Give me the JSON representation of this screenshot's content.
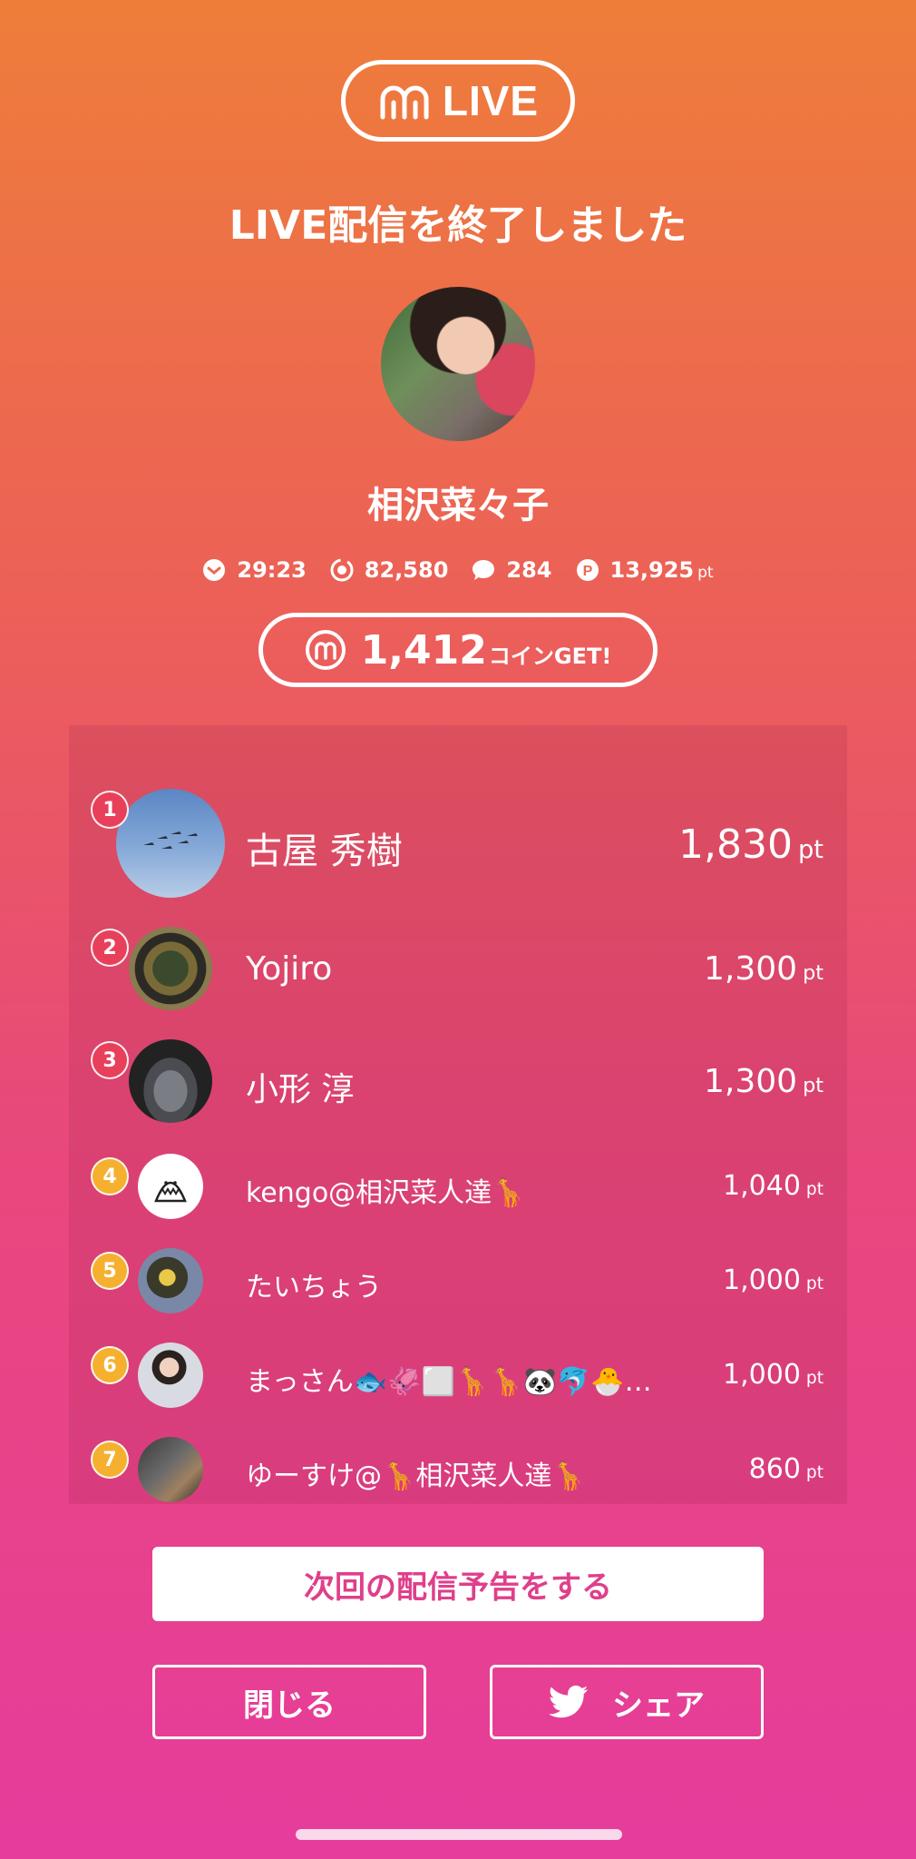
{
  "header": {
    "logo_text": "LIVE",
    "title": "LIVE配信を終了しました"
  },
  "streamer": {
    "name": "相沢菜々子"
  },
  "stats": {
    "duration": "29:23",
    "views": "82,580",
    "comments": "284",
    "points": "13,925",
    "points_unit": "pt"
  },
  "coins": {
    "amount": "1,412",
    "suffix": "コインGET!"
  },
  "ranking": [
    {
      "rank": "1",
      "name": "古屋 秀樹",
      "points": "1,830",
      "unit": "pt"
    },
    {
      "rank": "2",
      "name": "Yojiro",
      "points": "1,300",
      "unit": "pt"
    },
    {
      "rank": "3",
      "name": "小形 淳",
      "points": "1,300",
      "unit": "pt"
    },
    {
      "rank": "4",
      "name": "kengo@相沢菜人達🦒",
      "points": "1,040",
      "unit": "pt"
    },
    {
      "rank": "5",
      "name": "たいちょう",
      "points": "1,000",
      "unit": "pt"
    },
    {
      "rank": "6",
      "name": "まっさん🐟🦑⬜🦒🦒🐼🐬🐣…",
      "points": "1,000",
      "unit": "pt"
    },
    {
      "rank": "7",
      "name": "ゆーすけ@🦒相沢菜人達🦒",
      "points": "860",
      "unit": "pt"
    }
  ],
  "buttons": {
    "preview": "次回の配信予告をする",
    "close": "閉じる",
    "share": "シェア"
  },
  "colors": {
    "gradient_top": "#ee7d3a",
    "gradient_bottom": "#e63c9c",
    "rank_top3": "#e8405a",
    "rank_other": "#f5b030",
    "preview_text": "#df3f8b"
  }
}
